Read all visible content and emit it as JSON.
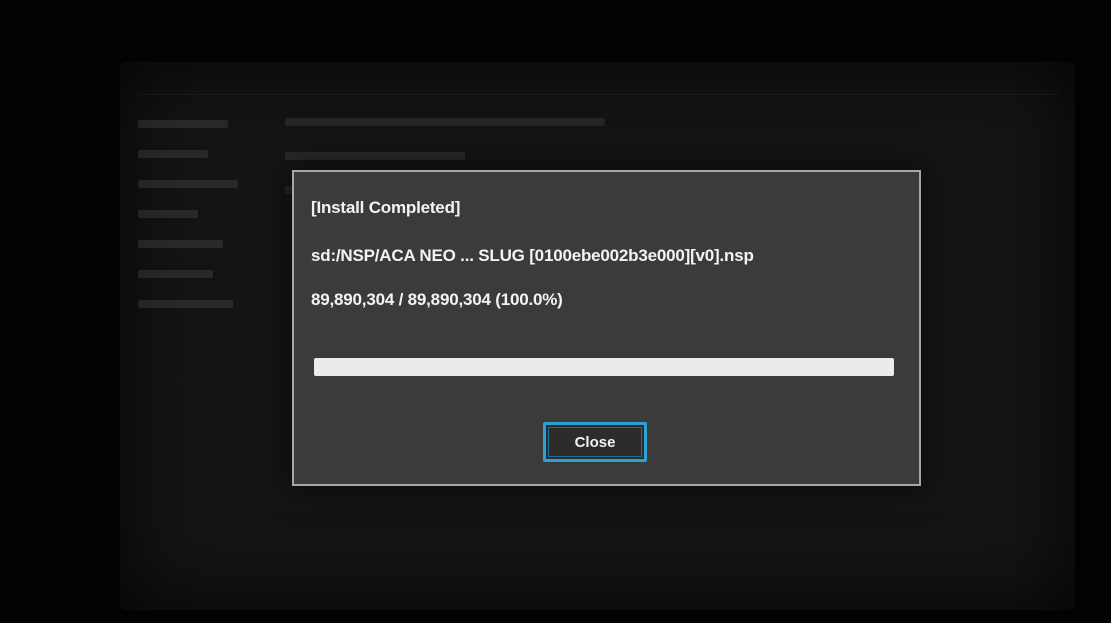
{
  "modal": {
    "title": "[Install Completed]",
    "file_path": "sd:/NSP/ACA NEO ... SLUG [0100ebe002b3e000][v0].nsp",
    "progress_text": "89,890,304 / 89,890,304 (100.0%)",
    "progress_fraction": 1.0,
    "close_label": "Close"
  },
  "colors": {
    "accent": "#2aa3d4",
    "modal_bg": "#3d3b3a",
    "progress_fill": "#ebebeb"
  }
}
